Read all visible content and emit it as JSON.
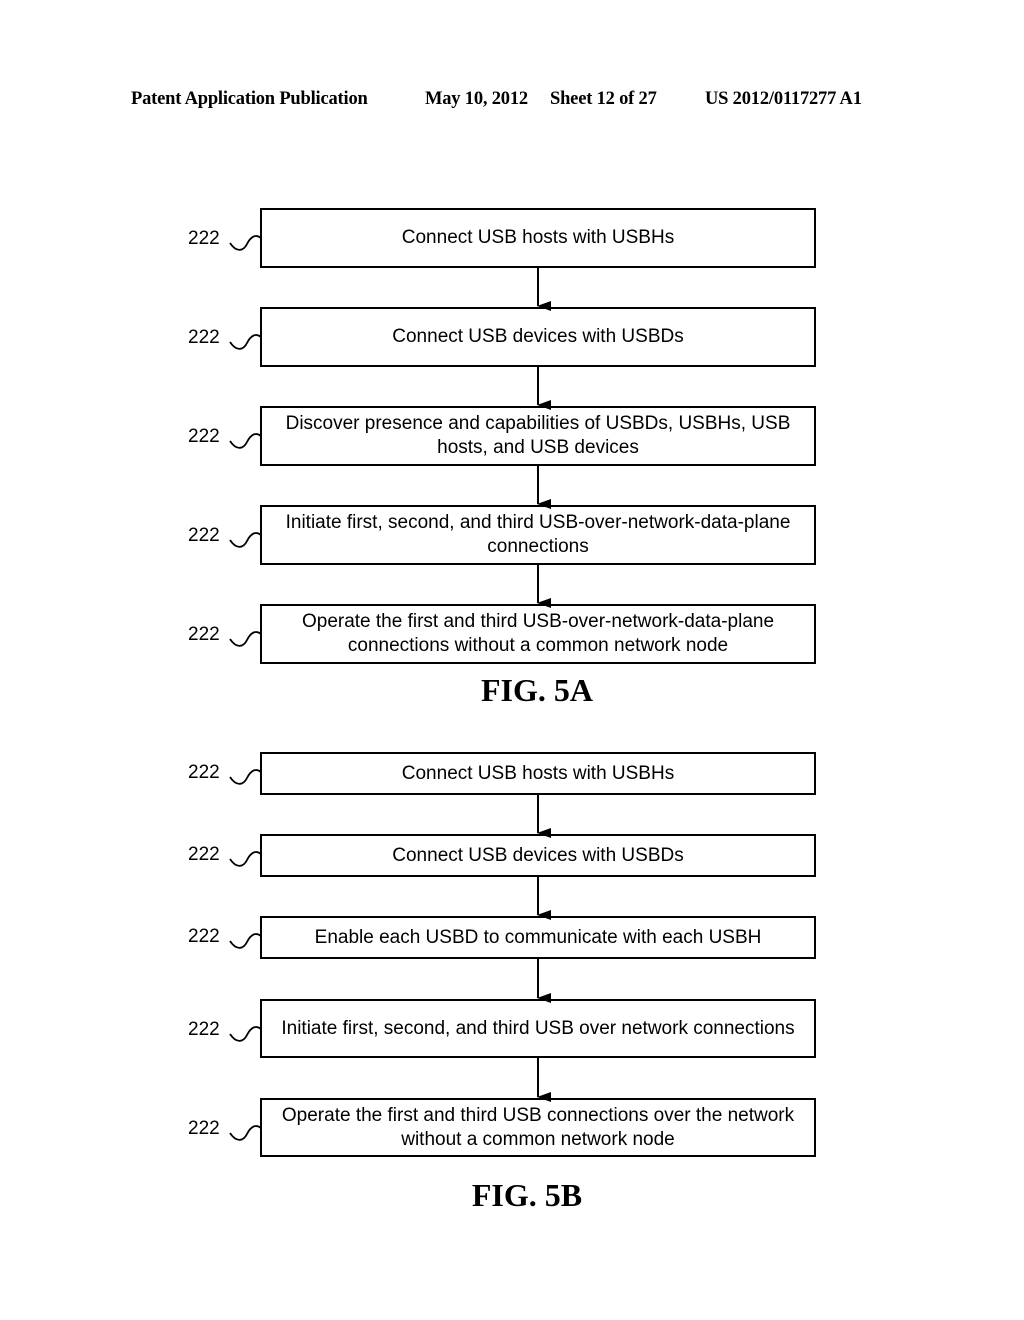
{
  "header": {
    "left": "Patent Application Publication",
    "date": "May 10, 2012",
    "sheet": "Sheet 12 of 27",
    "number": "US 2012/0117277 A1"
  },
  "fig5a": {
    "title": "FIG. 5A",
    "steps": [
      {
        "ref": "222",
        "text": "Connect USB hosts with USBHs"
      },
      {
        "ref": "222",
        "text": "Connect USB devices with USBDs"
      },
      {
        "ref": "222",
        "text": "Discover presence and capabilities of USBDs, USBHs, USB hosts, and USB devices"
      },
      {
        "ref": "222",
        "text": "Initiate first, second, and third USB-over-network-data-plane connections"
      },
      {
        "ref": "222",
        "text": "Operate the first and third USB-over-network-data-plane connections without a common network node"
      }
    ]
  },
  "fig5b": {
    "title": "FIG. 5B",
    "steps": [
      {
        "ref": "222",
        "text": "Connect USB hosts with USBHs"
      },
      {
        "ref": "222",
        "text": "Connect USB devices with USBDs"
      },
      {
        "ref": "222",
        "text": "Enable each USBD to communicate with each USBH"
      },
      {
        "ref": "222",
        "text": "Initiate first, second, and third USB over network connections"
      },
      {
        "ref": "222",
        "text": "Operate the first and third USB connections over the network without a common network node"
      }
    ]
  }
}
